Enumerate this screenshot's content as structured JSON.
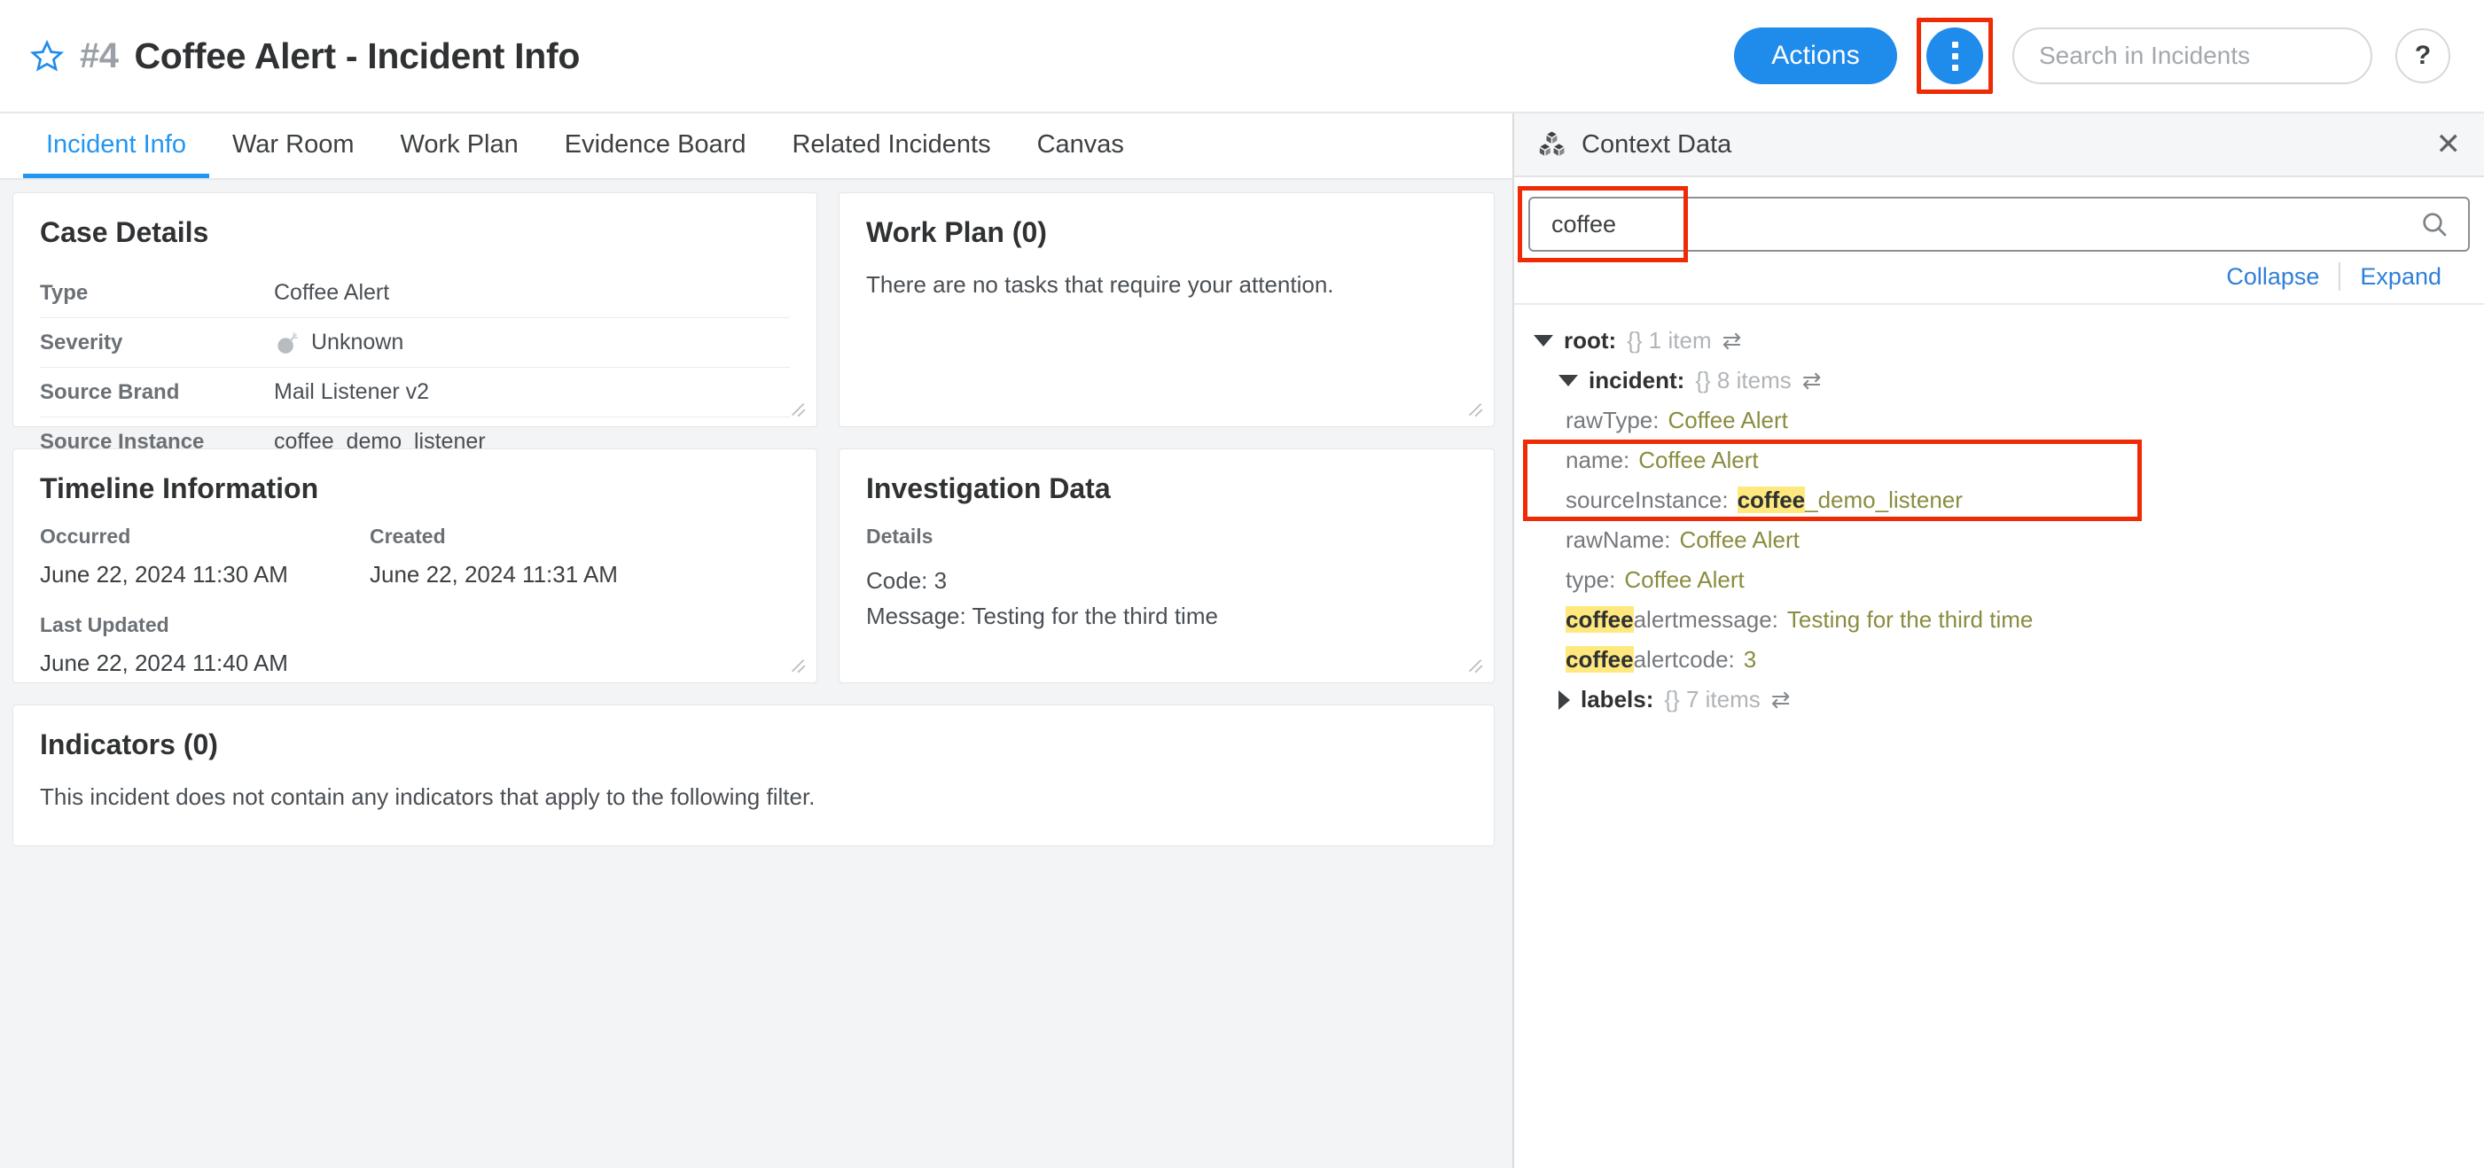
{
  "header": {
    "star_icon": "star-outline-icon",
    "incident_number": "#4",
    "title": "Coffee Alert - Incident Info",
    "actions_label": "Actions",
    "kebab_icon": "vertical-dots-icon",
    "search_placeholder": "Search in Incidents",
    "search_value": "",
    "help_label": "?"
  },
  "tabs": [
    {
      "label": "Incident Info",
      "active": true
    },
    {
      "label": "War Room",
      "active": false
    },
    {
      "label": "Work Plan",
      "active": false
    },
    {
      "label": "Evidence Board",
      "active": false
    },
    {
      "label": "Related Incidents",
      "active": false
    },
    {
      "label": "Canvas",
      "active": false
    }
  ],
  "case_details": {
    "title": "Case Details",
    "rows": [
      {
        "key": "Type",
        "value": "Coffee Alert",
        "icon": ""
      },
      {
        "key": "Severity",
        "value": "Unknown",
        "icon": "bomb-icon"
      },
      {
        "key": "Source Brand",
        "value": "Mail Listener v2",
        "icon": ""
      },
      {
        "key": "Source Instance",
        "value": "coffee_demo_listener",
        "icon": ""
      }
    ]
  },
  "work_plan": {
    "title": "Work Plan (0)",
    "empty_text": "There are no tasks that require your attention."
  },
  "timeline": {
    "title": "Timeline Information",
    "occurred_label": "Occurred",
    "occurred_value": "June 22, 2024 11:30 AM",
    "created_label": "Created",
    "created_value": "June 22, 2024 11:31 AM",
    "last_updated_label": "Last Updated",
    "last_updated_value": "June 22, 2024 11:40 AM"
  },
  "investigation": {
    "title": "Investigation Data",
    "details_label": "Details",
    "line1": "Code: 3",
    "line2": "Message: Testing for the third time"
  },
  "indicators": {
    "title": "Indicators (0)",
    "empty_text": "This incident does not contain any indicators that apply to the following filter."
  },
  "context_panel": {
    "icon": "cubes-icon",
    "title": "Context Data",
    "close_icon": "close-icon",
    "search_value": "coffee",
    "search_icon": "search-icon",
    "collapse_label": "Collapse",
    "expand_label": "Expand",
    "tree": [
      {
        "indent": 0,
        "arrow": "down",
        "key": "root:",
        "bold": true,
        "meta": "{} 1 item",
        "swap": "⇄"
      },
      {
        "indent": 1,
        "arrow": "down",
        "key": "incident:",
        "bold": true,
        "meta": "{} 8 items",
        "swap": "⇄"
      },
      {
        "indent": 1,
        "arrow": "none",
        "key": "rawType:",
        "bold": false,
        "value": "Coffee Alert"
      },
      {
        "indent": 1,
        "arrow": "none",
        "key": "name:",
        "bold": false,
        "value": "Coffee Alert"
      },
      {
        "indent": 1,
        "arrow": "none",
        "key_hl": "coffee",
        "key": "sourceInstance:",
        "bold": false,
        "value_hl": "coffee",
        "value": "_demo_listener"
      },
      {
        "indent": 1,
        "arrow": "none",
        "key": "rawName:",
        "bold": false,
        "value": "Coffee Alert"
      },
      {
        "indent": 1,
        "arrow": "none",
        "key": "type:",
        "bold": false,
        "value": "Coffee Alert"
      },
      {
        "indent": 1,
        "arrow": "none",
        "key_hl": "coffee",
        "key": "alertmessage:",
        "bold": false,
        "value": "Testing for the third time"
      },
      {
        "indent": 1,
        "arrow": "none",
        "key_hl": "coffee",
        "key": "alertcode:",
        "bold": false,
        "value": "3"
      },
      {
        "indent": 1,
        "arrow": "right",
        "key": "labels:",
        "bold": true,
        "meta": "{} 7 items",
        "swap": "⇄"
      }
    ]
  },
  "colors": {
    "accent_blue": "#1f8ceb",
    "tab_active": "#2196f3",
    "annotation_red": "#ef2b06",
    "highlight_yellow": "#ffe97f",
    "tree_value": "#8a8c3f"
  }
}
